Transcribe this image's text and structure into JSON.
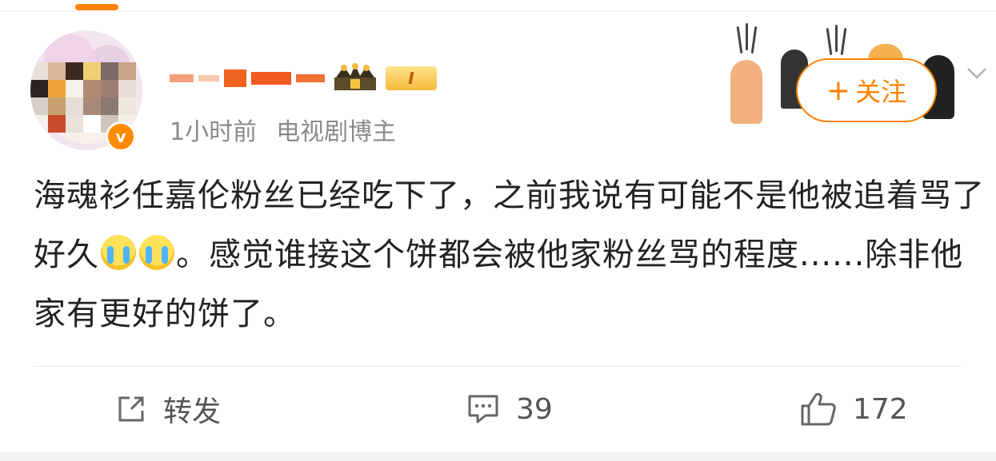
{
  "post": {
    "time": "1小时前",
    "source": "电视剧博主",
    "vip_level": "I",
    "follow_label": "关注",
    "text_parts": [
      "海魂衫任嘉伦粉丝已经吃下了，之前我说有可能不是他被追着骂了好久",
      "。感觉谁接这个饼都会被他家粉丝骂的程度......除非他家有更好的饼了。"
    ],
    "emoji": "crying-face"
  },
  "actions": {
    "repost_label": "转发",
    "comment_count": "39",
    "like_count": "172"
  },
  "colors": {
    "accent": "#ff8200",
    "text": "#222222",
    "meta": "#8a8a8a"
  }
}
